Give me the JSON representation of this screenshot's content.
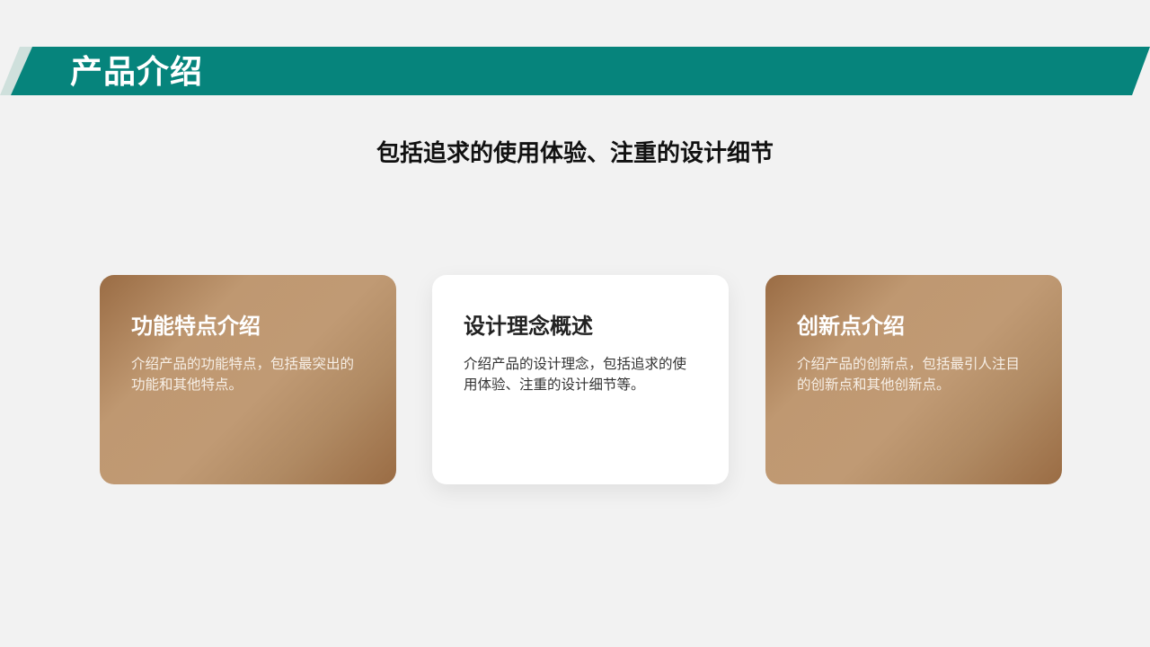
{
  "header": {
    "title": "产品介绍"
  },
  "subtitle": "包括追求的使用体验、注重的设计细节",
  "cards": [
    {
      "title": "功能特点介绍",
      "description": "介绍产品的功能特点，包括最突出的功能和其他特点。"
    },
    {
      "title": "设计理念概述",
      "description": "介绍产品的设计理念，包括追求的使用体验、注重的设计细节等。"
    },
    {
      "title": "创新点介绍",
      "description": "介绍产品的创新点，包括最引人注目的创新点和其他创新点。"
    }
  ],
  "colors": {
    "header_teal": "#06847c",
    "header_accent": "#cfe0dc",
    "card_bronze": "#b08a63",
    "background": "#f2f2f2"
  }
}
